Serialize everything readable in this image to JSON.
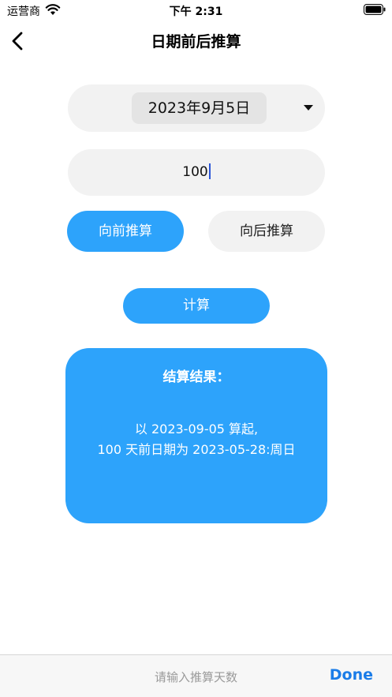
{
  "status_bar": {
    "carrier": "运营商",
    "time": "下午 2:31"
  },
  "nav": {
    "title": "日期前后推算"
  },
  "date_picker": {
    "value": "2023年9月5日"
  },
  "days_input": {
    "value": "100"
  },
  "direction": {
    "forward_label": "向前推算",
    "backward_label": "向后推算",
    "selected": "forward"
  },
  "calculate": {
    "label": "计算"
  },
  "result": {
    "title": "结算结果：",
    "line1": "以 2023-09-05 算起,",
    "line2": "100 天前日期为 2023-05-28:周日"
  },
  "keyboard_toolbar": {
    "placeholder": "请输入推算天数",
    "done_label": "Done"
  },
  "colors": {
    "accent": "#2da3fb",
    "field_bg": "#f2f2f2",
    "done": "#1a7ce8"
  },
  "icons": [
    "wifi-icon",
    "battery-icon",
    "back-chevron-icon",
    "dropdown-caret-icon"
  ]
}
